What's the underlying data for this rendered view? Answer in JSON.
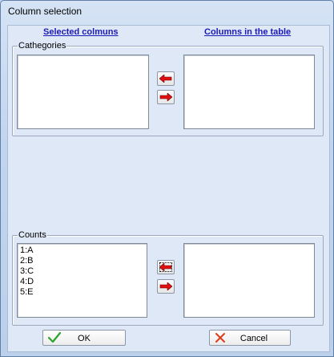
{
  "window": {
    "title": "Column selection"
  },
  "headers": {
    "selected": "Selected colmuns",
    "available": "Columns in the table"
  },
  "categories": {
    "label": "Cathegories",
    "selected_items": [],
    "available_items": []
  },
  "counts": {
    "label": "Counts",
    "selected_items": [
      "1:A",
      "2:B",
      "3:C",
      "4:D",
      "5:E"
    ],
    "available_items": []
  },
  "buttons": {
    "ok": "OK",
    "cancel": "Cancel"
  },
  "icons": {
    "move_left": "red-arrow-left-icon",
    "move_right": "red-arrow-right-icon",
    "ok": "green-check-icon",
    "cancel": "red-x-icon"
  },
  "colors": {
    "arrow": "#e01010",
    "header_link": "#1a1ab8",
    "check": "#2aa52a",
    "cross": "#e23a1a"
  }
}
